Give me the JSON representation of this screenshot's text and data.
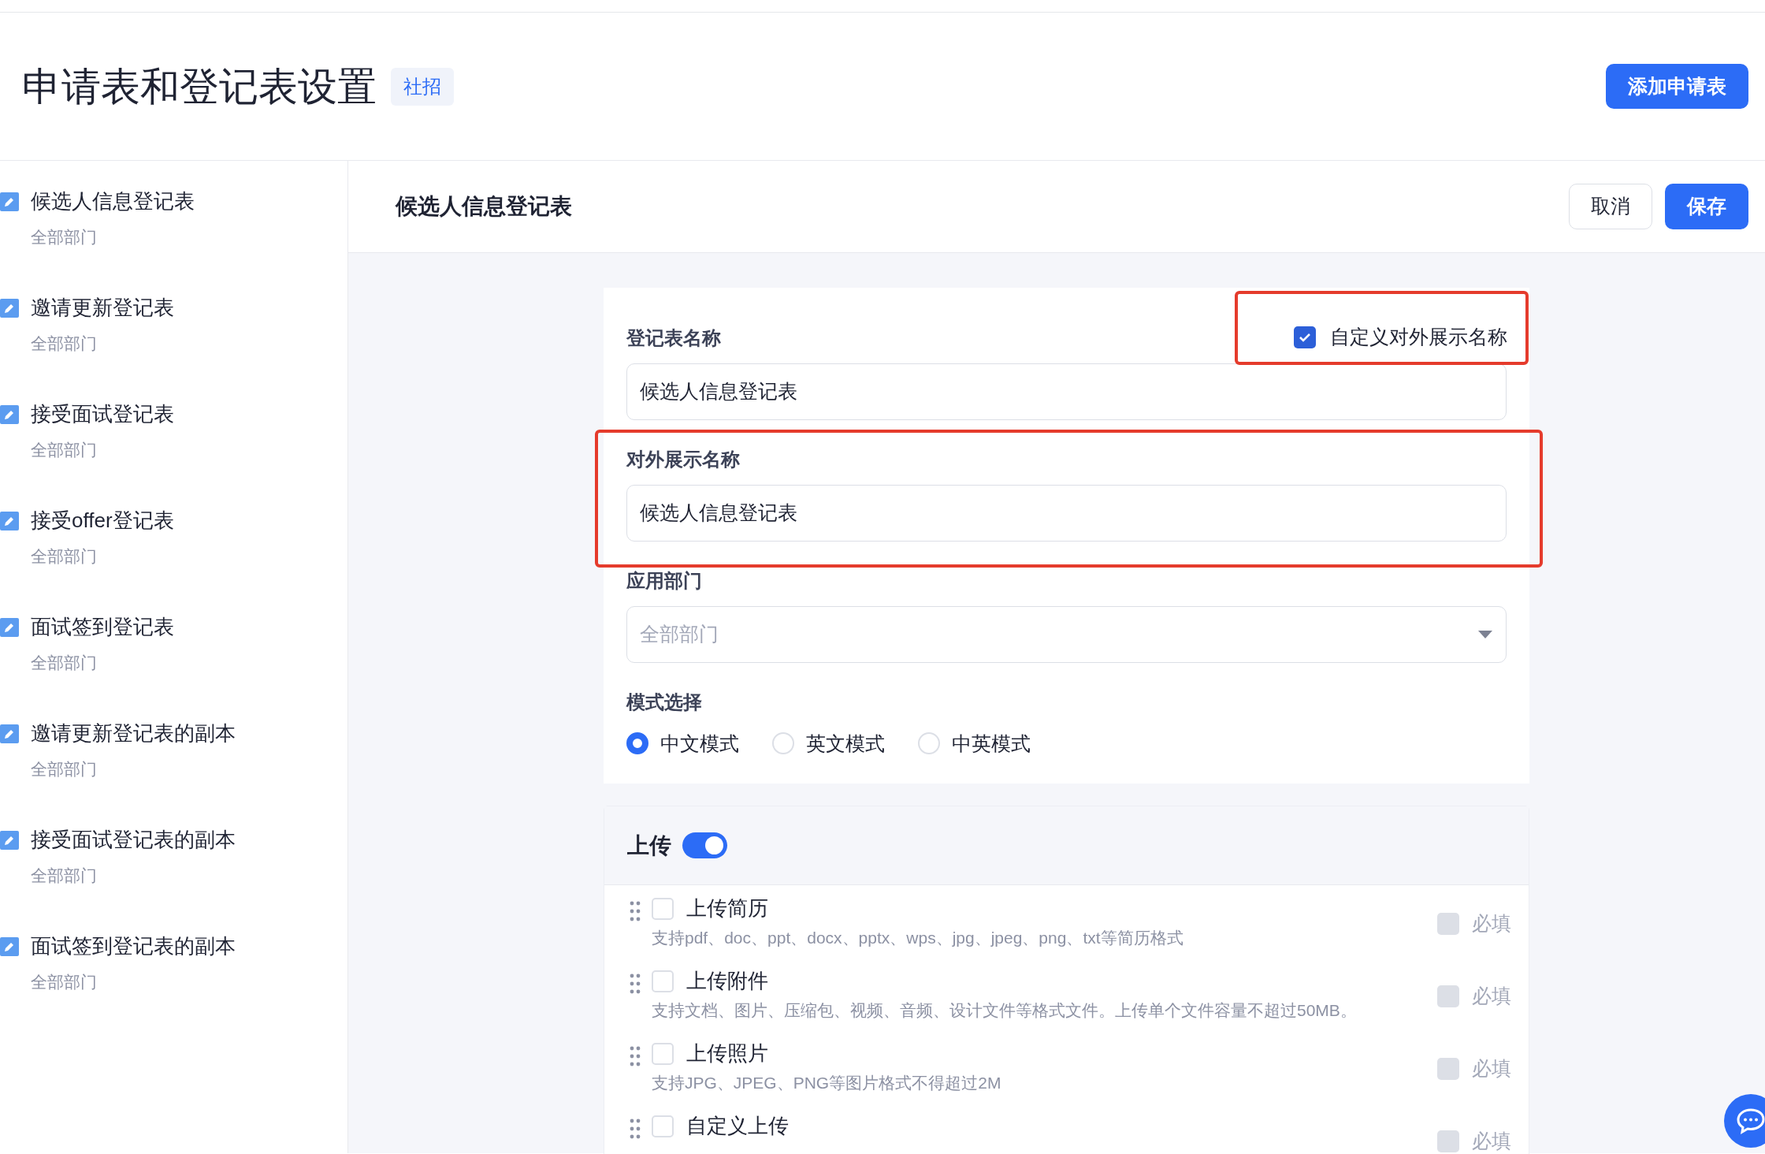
{
  "header": {
    "title": "申请表和登记表设置",
    "badge": "社招",
    "add_button": "添加申请表"
  },
  "sidebar": {
    "items": [
      {
        "title": "候选人信息登记表",
        "subtitle": "全部部门"
      },
      {
        "title": "邀请更新登记表",
        "subtitle": "全部部门"
      },
      {
        "title": "接受面试登记表",
        "subtitle": "全部部门"
      },
      {
        "title": "接受offer登记表",
        "subtitle": "全部部门"
      },
      {
        "title": "面试签到登记表",
        "subtitle": "全部部门"
      },
      {
        "title": "邀请更新登记表的副本",
        "subtitle": "全部部门"
      },
      {
        "title": "接受面试登记表的副本",
        "subtitle": "全部部门"
      },
      {
        "title": "面试签到登记表的副本",
        "subtitle": "全部部门"
      }
    ]
  },
  "editor": {
    "title": "候选人信息登记表",
    "cancel_button": "取消",
    "save_button": "保存"
  },
  "form": {
    "name_label": "登记表名称",
    "custom_name": {
      "label": "自定义对外展示名称",
      "checked": true,
      "highlighted": true
    },
    "name_value": "候选人信息登记表",
    "display_name": {
      "label": "对外展示名称",
      "value": "候选人信息登记表",
      "highlighted": true
    },
    "department": {
      "label": "应用部门",
      "placeholder": "全部部门"
    },
    "mode": {
      "label": "模式选择",
      "options": [
        {
          "label": "中文模式",
          "selected": true
        },
        {
          "label": "英文模式",
          "selected": false
        },
        {
          "label": "中英模式",
          "selected": false
        }
      ]
    }
  },
  "upload": {
    "title": "上传",
    "on": true,
    "items": [
      {
        "title": "上传简历",
        "description": "支持pdf、doc、ppt、docx、pptx、wps、jpg、jpeg、png、txt等简历格式",
        "checked": false,
        "required_label": "必填",
        "required": false
      },
      {
        "title": "上传附件",
        "description": "支持文档、图片、压缩包、视频、音频、设计文件等格式文件。上传单个文件容量不超过50MB。",
        "checked": false,
        "required_label": "必填",
        "required": false
      },
      {
        "title": "上传照片",
        "description": "支持JPG、JPEG、PNG等图片格式不得超过2M",
        "checked": false,
        "required_label": "必填",
        "required": false
      },
      {
        "title": "自定义上传",
        "checked": false,
        "required_label": "必填",
        "required": false
      }
    ]
  }
}
